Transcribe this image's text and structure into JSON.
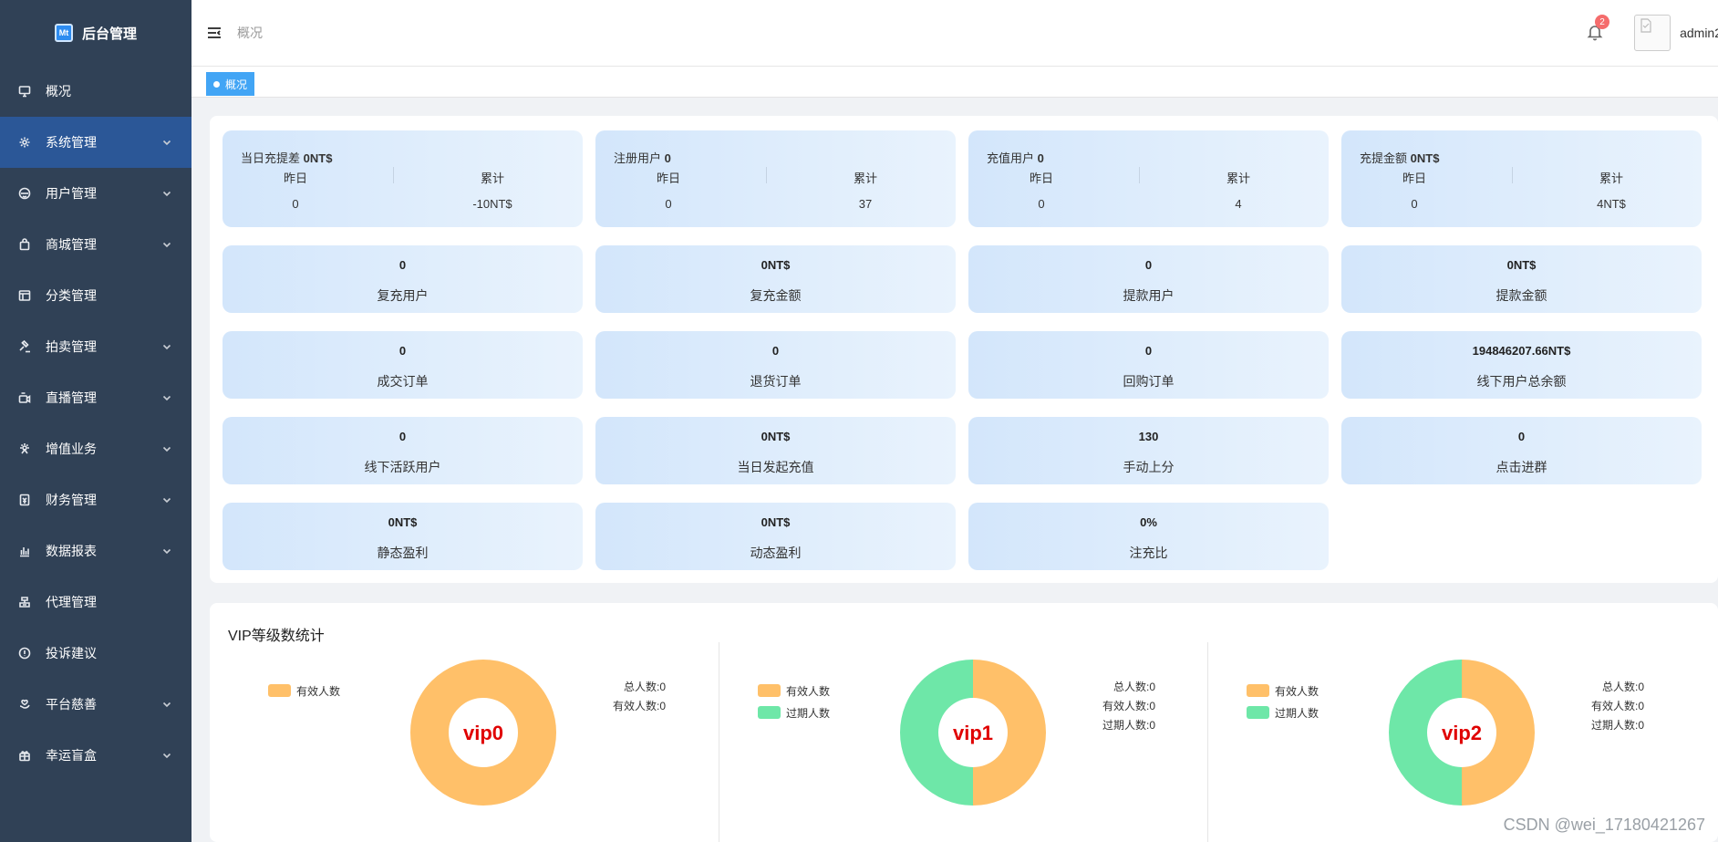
{
  "app": {
    "title": "后台管理",
    "logo_text": "Mt"
  },
  "sidebar": {
    "items": [
      {
        "label": "概况",
        "icon": "monitor-icon",
        "expandable": false,
        "active": false
      },
      {
        "label": "系统管理",
        "icon": "gear-icon",
        "expandable": true,
        "active": true
      },
      {
        "label": "用户管理",
        "icon": "user-circle-icon",
        "expandable": true,
        "active": false
      },
      {
        "label": "商城管理",
        "icon": "shopping-bag-icon",
        "expandable": true,
        "active": false
      },
      {
        "label": "分类管理",
        "icon": "category-icon",
        "expandable": false,
        "active": false
      },
      {
        "label": "拍卖管理",
        "icon": "gavel-icon",
        "expandable": true,
        "active": false
      },
      {
        "label": "直播管理",
        "icon": "live-icon",
        "expandable": true,
        "active": false
      },
      {
        "label": "增值业务",
        "icon": "value-added-icon",
        "expandable": true,
        "active": false
      },
      {
        "label": "财务管理",
        "icon": "finance-icon",
        "expandable": true,
        "active": false
      },
      {
        "label": "数据报表",
        "icon": "bar-chart-icon",
        "expandable": true,
        "active": false
      },
      {
        "label": "代理管理",
        "icon": "agent-icon",
        "expandable": false,
        "active": false
      },
      {
        "label": "投诉建议",
        "icon": "info-icon",
        "expandable": false,
        "active": false
      },
      {
        "label": "平台慈善",
        "icon": "charity-icon",
        "expandable": true,
        "active": false
      },
      {
        "label": "幸运盲盒",
        "icon": "gift-box-icon",
        "expandable": true,
        "active": false
      }
    ]
  },
  "header": {
    "breadcrumb": "概况",
    "notification_count": "2",
    "username": "admin2"
  },
  "tags": {
    "active_tag": "概况"
  },
  "stats": {
    "top_cards": [
      {
        "title": "当日充提差",
        "value": "0NT$",
        "yesterday_label": "昨日",
        "total_label": "累计",
        "yesterday": "0",
        "total": "-10NT$"
      },
      {
        "title": "注册用户",
        "value": "0",
        "yesterday_label": "昨日",
        "total_label": "累计",
        "yesterday": "0",
        "total": "37"
      },
      {
        "title": "充值用户",
        "value": "0",
        "yesterday_label": "昨日",
        "total_label": "累计",
        "yesterday": "0",
        "total": "4"
      },
      {
        "title": "充提金额",
        "value": "0NT$",
        "yesterday_label": "昨日",
        "total_label": "累计",
        "yesterday": "0",
        "total": "4NT$"
      }
    ],
    "small_cards": [
      {
        "value": "0",
        "label": "复充用户"
      },
      {
        "value": "0NT$",
        "label": "复充金额"
      },
      {
        "value": "0",
        "label": "提款用户"
      },
      {
        "value": "0NT$",
        "label": "提款金额"
      },
      {
        "value": "0",
        "label": "成交订单"
      },
      {
        "value": "0",
        "label": "退货订单"
      },
      {
        "value": "0",
        "label": "回购订单"
      },
      {
        "value": "194846207.66NT$",
        "label": "线下用户总余额"
      },
      {
        "value": "0",
        "label": "线下活跃用户"
      },
      {
        "value": "0NT$",
        "label": "当日发起充值"
      },
      {
        "value": "130",
        "label": "手动上分"
      },
      {
        "value": "0",
        "label": "点击进群"
      },
      {
        "value": "0NT$",
        "label": "静态盈利"
      },
      {
        "value": "0NT$",
        "label": "动态盈利"
      },
      {
        "value": "0%",
        "label": "注充比"
      }
    ]
  },
  "vip": {
    "title": "VIP等级数统计",
    "colors": {
      "effective": "#ffc069",
      "expired": "#6ee7a8"
    },
    "blocks": [
      {
        "name": "vip0",
        "legend": [
          "有效人数"
        ],
        "info": [
          "总人数:0",
          "有效人数:0"
        ],
        "shares": {
          "effective": 1.0,
          "expired": 0.0
        }
      },
      {
        "name": "vip1",
        "legend": [
          "有效人数",
          "过期人数"
        ],
        "info": [
          "总人数:0",
          "有效人数:0",
          "过期人数:0"
        ],
        "shares": {
          "effective": 0.5,
          "expired": 0.5
        }
      },
      {
        "name": "vip2",
        "legend": [
          "有效人数",
          "过期人数"
        ],
        "info": [
          "总人数:0",
          "有效人数:0",
          "过期人数:0"
        ],
        "shares": {
          "effective": 0.5,
          "expired": 0.5
        }
      }
    ]
  },
  "watermark": "CSDN @wei_17180421267"
}
